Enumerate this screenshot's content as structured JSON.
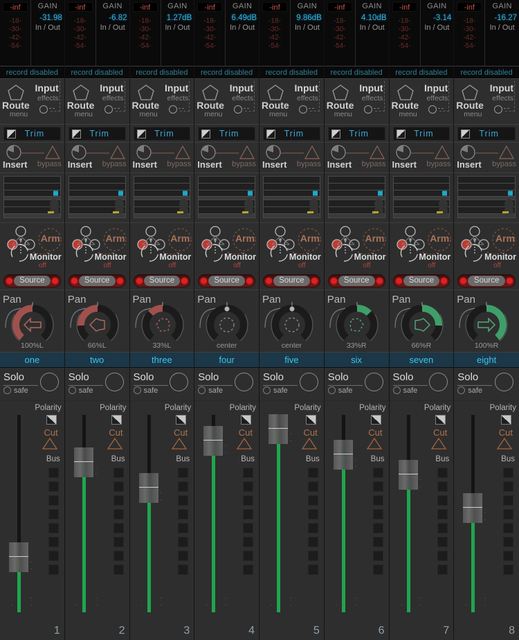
{
  "meta": {
    "channel_count": 8
  },
  "meter": {
    "peak_label": "-inf",
    "gain_label": "GAIN",
    "inout_label": "In / Out",
    "scale_ticks": [
      "-18-",
      "-30-",
      "-42-",
      "-54-"
    ],
    "record_status": "record disabled"
  },
  "route": {
    "route_label": "Route",
    "route_sub": "menu",
    "input_label": "Input",
    "input_sub": "effects"
  },
  "trim": {
    "label": "Trim"
  },
  "insert": {
    "label": "Insert",
    "bypass_label": "bypass"
  },
  "arm": {
    "label": "Arm",
    "monitor_label": "Monitor",
    "monitor_state": "off"
  },
  "source": {
    "label": "Source"
  },
  "pan": {
    "label": "Pan"
  },
  "solo": {
    "label": "Solo",
    "safe_label": "safe"
  },
  "fader_section": {
    "polarity_label": "Polarity",
    "cut_label": "Cut",
    "bus_label": "Bus",
    "bus_count": 8,
    "tick_glyph": ". ."
  },
  "colors": {
    "accent_blue": "#38c6f0",
    "gain_blue": "#31b6e6",
    "fader_green": "#1fa54e",
    "pan_left": "#a05050",
    "pan_right": "#3f9e6a",
    "cut_orange": "#b2724e",
    "record_teal": "#2f7f96",
    "peak_red": "#c4564a",
    "name_bar_bg": "#1c3747"
  },
  "channels": [
    {
      "number": "1",
      "name": "one",
      "gain": "-31.98",
      "pan_value": "100%L",
      "pan_percent": -100,
      "fader_pos": 0.28
    },
    {
      "number": "2",
      "name": "two",
      "gain": "-6.82",
      "pan_value": "66%L",
      "pan_percent": -66,
      "fader_pos": 0.76
    },
    {
      "number": "3",
      "name": "three",
      "gain": "1.27dB",
      "pan_value": "33%L",
      "pan_percent": -33,
      "fader_pos": 0.63
    },
    {
      "number": "4",
      "name": "four",
      "gain": "6.49dB",
      "pan_value": "center",
      "pan_percent": 0,
      "fader_pos": 0.87
    },
    {
      "number": "5",
      "name": "five",
      "gain": "9.86dB",
      "pan_value": "center",
      "pan_percent": 0,
      "fader_pos": 0.93
    },
    {
      "number": "6",
      "name": "six",
      "gain": "4.10dB",
      "pan_value": "33%R",
      "pan_percent": 33,
      "fader_pos": 0.8
    },
    {
      "number": "7",
      "name": "seven",
      "gain": "-3.14",
      "pan_value": "66%R",
      "pan_percent": 66,
      "fader_pos": 0.7
    },
    {
      "number": "8",
      "name": "eight",
      "gain": "-16.27",
      "pan_value": "100%R",
      "pan_percent": 100,
      "fader_pos": 0.53
    }
  ]
}
